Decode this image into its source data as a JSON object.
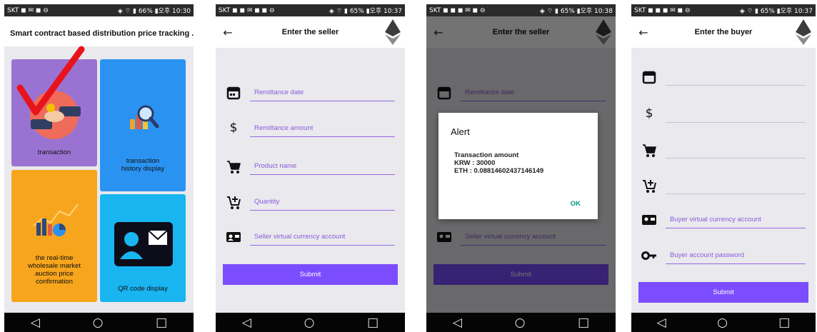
{
  "status": {
    "p1": {
      "left": "SKT ◼ ✉ ◼ ⊖",
      "right": "◈ ⌔ ▮ 66% ▮오후 10:30"
    },
    "p2": {
      "left": "SKT ◼ ◼ ✉ ◼ ◼ ⊖",
      "right": "◈ ⌔ ▮ 65% ▮오후 10:37"
    },
    "p3": {
      "left": "SKT ◼ ◼ ◼ ✉ ◼ ⊖",
      "right": "◈ ⌔ ▮ 65% ▮오후 10:38"
    },
    "p4": {
      "left": "SKT ◼ ◼ ◼ ✉ ◼ ⊖",
      "right": "◈ ⌔ ▮ 65% ▮오후 10:37"
    }
  },
  "nav": {
    "back": "◁",
    "home": "○",
    "recent": "□"
  },
  "home": {
    "title": "Smart contract based distribution price tracking ...",
    "tiles": {
      "transaction": "transaction",
      "history": "transaction\nhistory display",
      "auction": "the real-time\nwholesale market\nauction price\nconfirmation",
      "qr": "QR code display"
    }
  },
  "seller": {
    "title": "Enter the seller",
    "back": "←",
    "fields": {
      "date": "Remittance date",
      "amount": "Remittance amount",
      "product": "Product name",
      "quantity": "Quantity",
      "account": "Seller virtual currency account"
    },
    "submit": "Submit"
  },
  "alert": {
    "title": "Alert",
    "message": "Transaction amount\nKRW : 30000\nETH : 0.08814602437146149",
    "ok": "OK"
  },
  "buyer": {
    "title": "Enter the buyer",
    "back": "←",
    "fields": {
      "account": "Buyer virtual currency account",
      "password": "Buyer account password"
    },
    "submit": "Submit"
  },
  "icons": {
    "calendar": "calendar-icon",
    "dollar": "dollar-icon",
    "cart": "cart-icon",
    "cart_add": "cart-add-icon",
    "id_card": "id-card-icon",
    "key": "key-icon",
    "ethereum": "ethereum-icon"
  },
  "colors": {
    "accent": "#7c4dff",
    "purple_tile": "#9a73d2",
    "blue_tile": "#2a93f2",
    "orange_tile": "#f7a51c",
    "cyan_tile": "#19b5f0",
    "check_mark": "#e8141b"
  }
}
